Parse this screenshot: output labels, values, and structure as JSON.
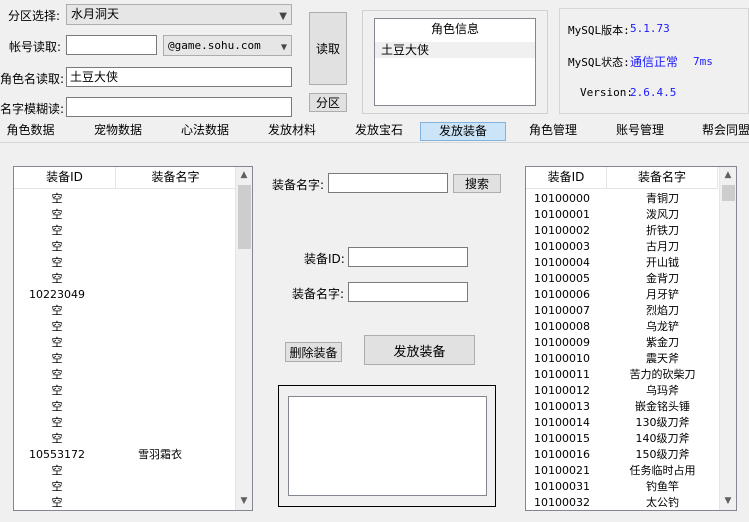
{
  "top": {
    "zone_label": "分区选择:",
    "zone_value": "水月洞天",
    "account_label": "帐号读取:",
    "account_value": "",
    "domain_value": "@game.sohu.com",
    "role_name_label": "角色名读取:",
    "role_name_value": "土豆大侠",
    "fuzzy_label": "名字模糊读:",
    "fuzzy_value": "",
    "read_button": "读取",
    "zone_button": "分区"
  },
  "role_info": {
    "title": "角色信息",
    "items": [
      "土豆大侠"
    ]
  },
  "mysql": {
    "version_label": "MySQL版本:",
    "version_value": "5.1.73",
    "status_label": "MySQL状态:",
    "status_value": "通信正常",
    "latency": "7ms",
    "app_version_label": "Version:",
    "app_version_value": "2.6.4.5"
  },
  "tabs": [
    "角色数据",
    "宠物数据",
    "心法数据",
    "发放材料",
    "发放宝石",
    "发放装备",
    "角色管理",
    "账号管理",
    "帮会同盟"
  ],
  "active_tab": "发放装备",
  "equip_list": {
    "col_id": "装备ID",
    "col_name": "装备名字",
    "rows": [
      [
        "空",
        ""
      ],
      [
        "空",
        ""
      ],
      [
        "空",
        ""
      ],
      [
        "空",
        ""
      ],
      [
        "空",
        ""
      ],
      [
        "空",
        ""
      ],
      [
        "10223049",
        ""
      ],
      [
        "空",
        ""
      ],
      [
        "空",
        ""
      ],
      [
        "空",
        ""
      ],
      [
        "空",
        ""
      ],
      [
        "空",
        ""
      ],
      [
        "空",
        ""
      ],
      [
        "空",
        ""
      ],
      [
        "空",
        ""
      ],
      [
        "空",
        ""
      ],
      [
        "10553172",
        "雪羽霜衣"
      ],
      [
        "空",
        ""
      ],
      [
        "空",
        ""
      ],
      [
        "空",
        ""
      ]
    ]
  },
  "form": {
    "search_label": "装备名字:",
    "search_value": "",
    "search_button": "搜索",
    "id_label": "装备ID:",
    "id_value": "",
    "name_label": "装备名字:",
    "name_value": "",
    "delete_button": "删除装备",
    "issue_button": "发放装备"
  },
  "catalog": {
    "col_id": "装备ID",
    "col_name": "装备名字",
    "rows": [
      [
        "10100000",
        "青铜刀"
      ],
      [
        "10100001",
        "泼风刀"
      ],
      [
        "10100002",
        "折铁刀"
      ],
      [
        "10100003",
        "古月刀"
      ],
      [
        "10100004",
        "开山钺"
      ],
      [
        "10100005",
        "金背刀"
      ],
      [
        "10100006",
        "月牙铲"
      ],
      [
        "10100007",
        "烈焰刀"
      ],
      [
        "10100008",
        "乌龙铲"
      ],
      [
        "10100009",
        "紫金刀"
      ],
      [
        "10100010",
        "震天斧"
      ],
      [
        "10100011",
        "苦力的砍柴刀"
      ],
      [
        "10100012",
        "乌玛斧"
      ],
      [
        "10100013",
        "嵌金铭头锤"
      ],
      [
        "10100014",
        "130级刀斧"
      ],
      [
        "10100015",
        "140级刀斧"
      ],
      [
        "10100016",
        "150级刀斧"
      ],
      [
        "10100021",
        "任务临时占用"
      ],
      [
        "10100031",
        "钓鱼竿"
      ],
      [
        "10100032",
        "太公钓"
      ]
    ]
  }
}
